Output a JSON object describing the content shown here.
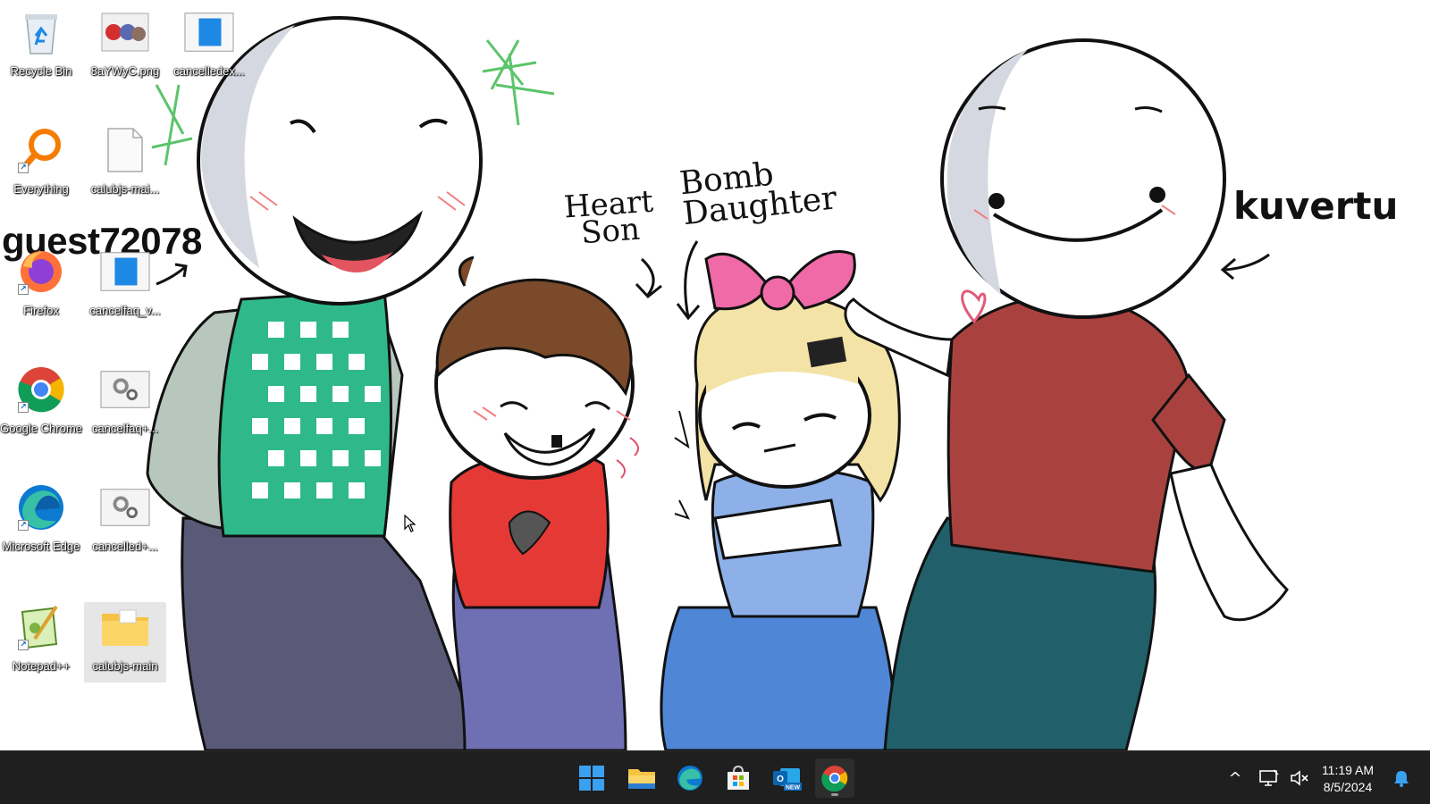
{
  "desktop": {
    "wallpaper": {
      "username": "guest72078",
      "annotations": {
        "heart_son": "Heart Son",
        "bomb_daughter": "Bomb Daughter",
        "kuvertu": "kuvertu"
      }
    },
    "icons": [
      {
        "label": "Recycle Bin",
        "icon": "recycle-bin-icon"
      },
      {
        "label": "8aYWyC.png",
        "icon": "image-file-icon"
      },
      {
        "label": "cancelledex...",
        "icon": "document-file-icon"
      },
      {
        "label": "Everything",
        "icon": "everything-search-icon",
        "shortcut": true
      },
      {
        "label": "calubjs-mai...",
        "icon": "blank-file-icon"
      },
      {
        "label": "Firefox",
        "icon": "firefox-icon",
        "shortcut": true
      },
      {
        "label": "cancelfaq_v...",
        "icon": "document-file-icon"
      },
      {
        "label": "Google Chrome",
        "icon": "chrome-icon",
        "shortcut": true
      },
      {
        "label": "cancelfaq+...",
        "icon": "settings-file-icon"
      },
      {
        "label": "Microsoft Edge",
        "icon": "edge-icon",
        "shortcut": true
      },
      {
        "label": "cancelled+...",
        "icon": "settings-file-icon"
      },
      {
        "label": "Notepad++",
        "icon": "notepad-plus-plus-icon",
        "shortcut": true
      },
      {
        "label": "calubjs-main",
        "icon": "folder-icon",
        "selected": true
      }
    ]
  },
  "taskbar": {
    "pinned": [
      {
        "name": "start",
        "icon": "windows-start-icon"
      },
      {
        "name": "file-explorer",
        "icon": "folder-icon"
      },
      {
        "name": "edge",
        "icon": "edge-icon"
      },
      {
        "name": "microsoft-store",
        "icon": "store-icon"
      },
      {
        "name": "outlook-new",
        "icon": "outlook-icon",
        "badge": "NEW"
      },
      {
        "name": "chrome",
        "icon": "chrome-icon",
        "running": true
      }
    ],
    "tray": {
      "show_hidden": "^",
      "time": "11:19 AM",
      "date": "8/5/2024"
    }
  },
  "colors": {
    "taskbar_bg": "#1f1f1f",
    "accent_blue": "#0078d4",
    "bow_pink": "#f06aa8",
    "vest_green": "#2fb98a",
    "shirt_red": "#a9423f",
    "shirt_brown": "#e53935",
    "dress_blue": "#4f86d6"
  }
}
